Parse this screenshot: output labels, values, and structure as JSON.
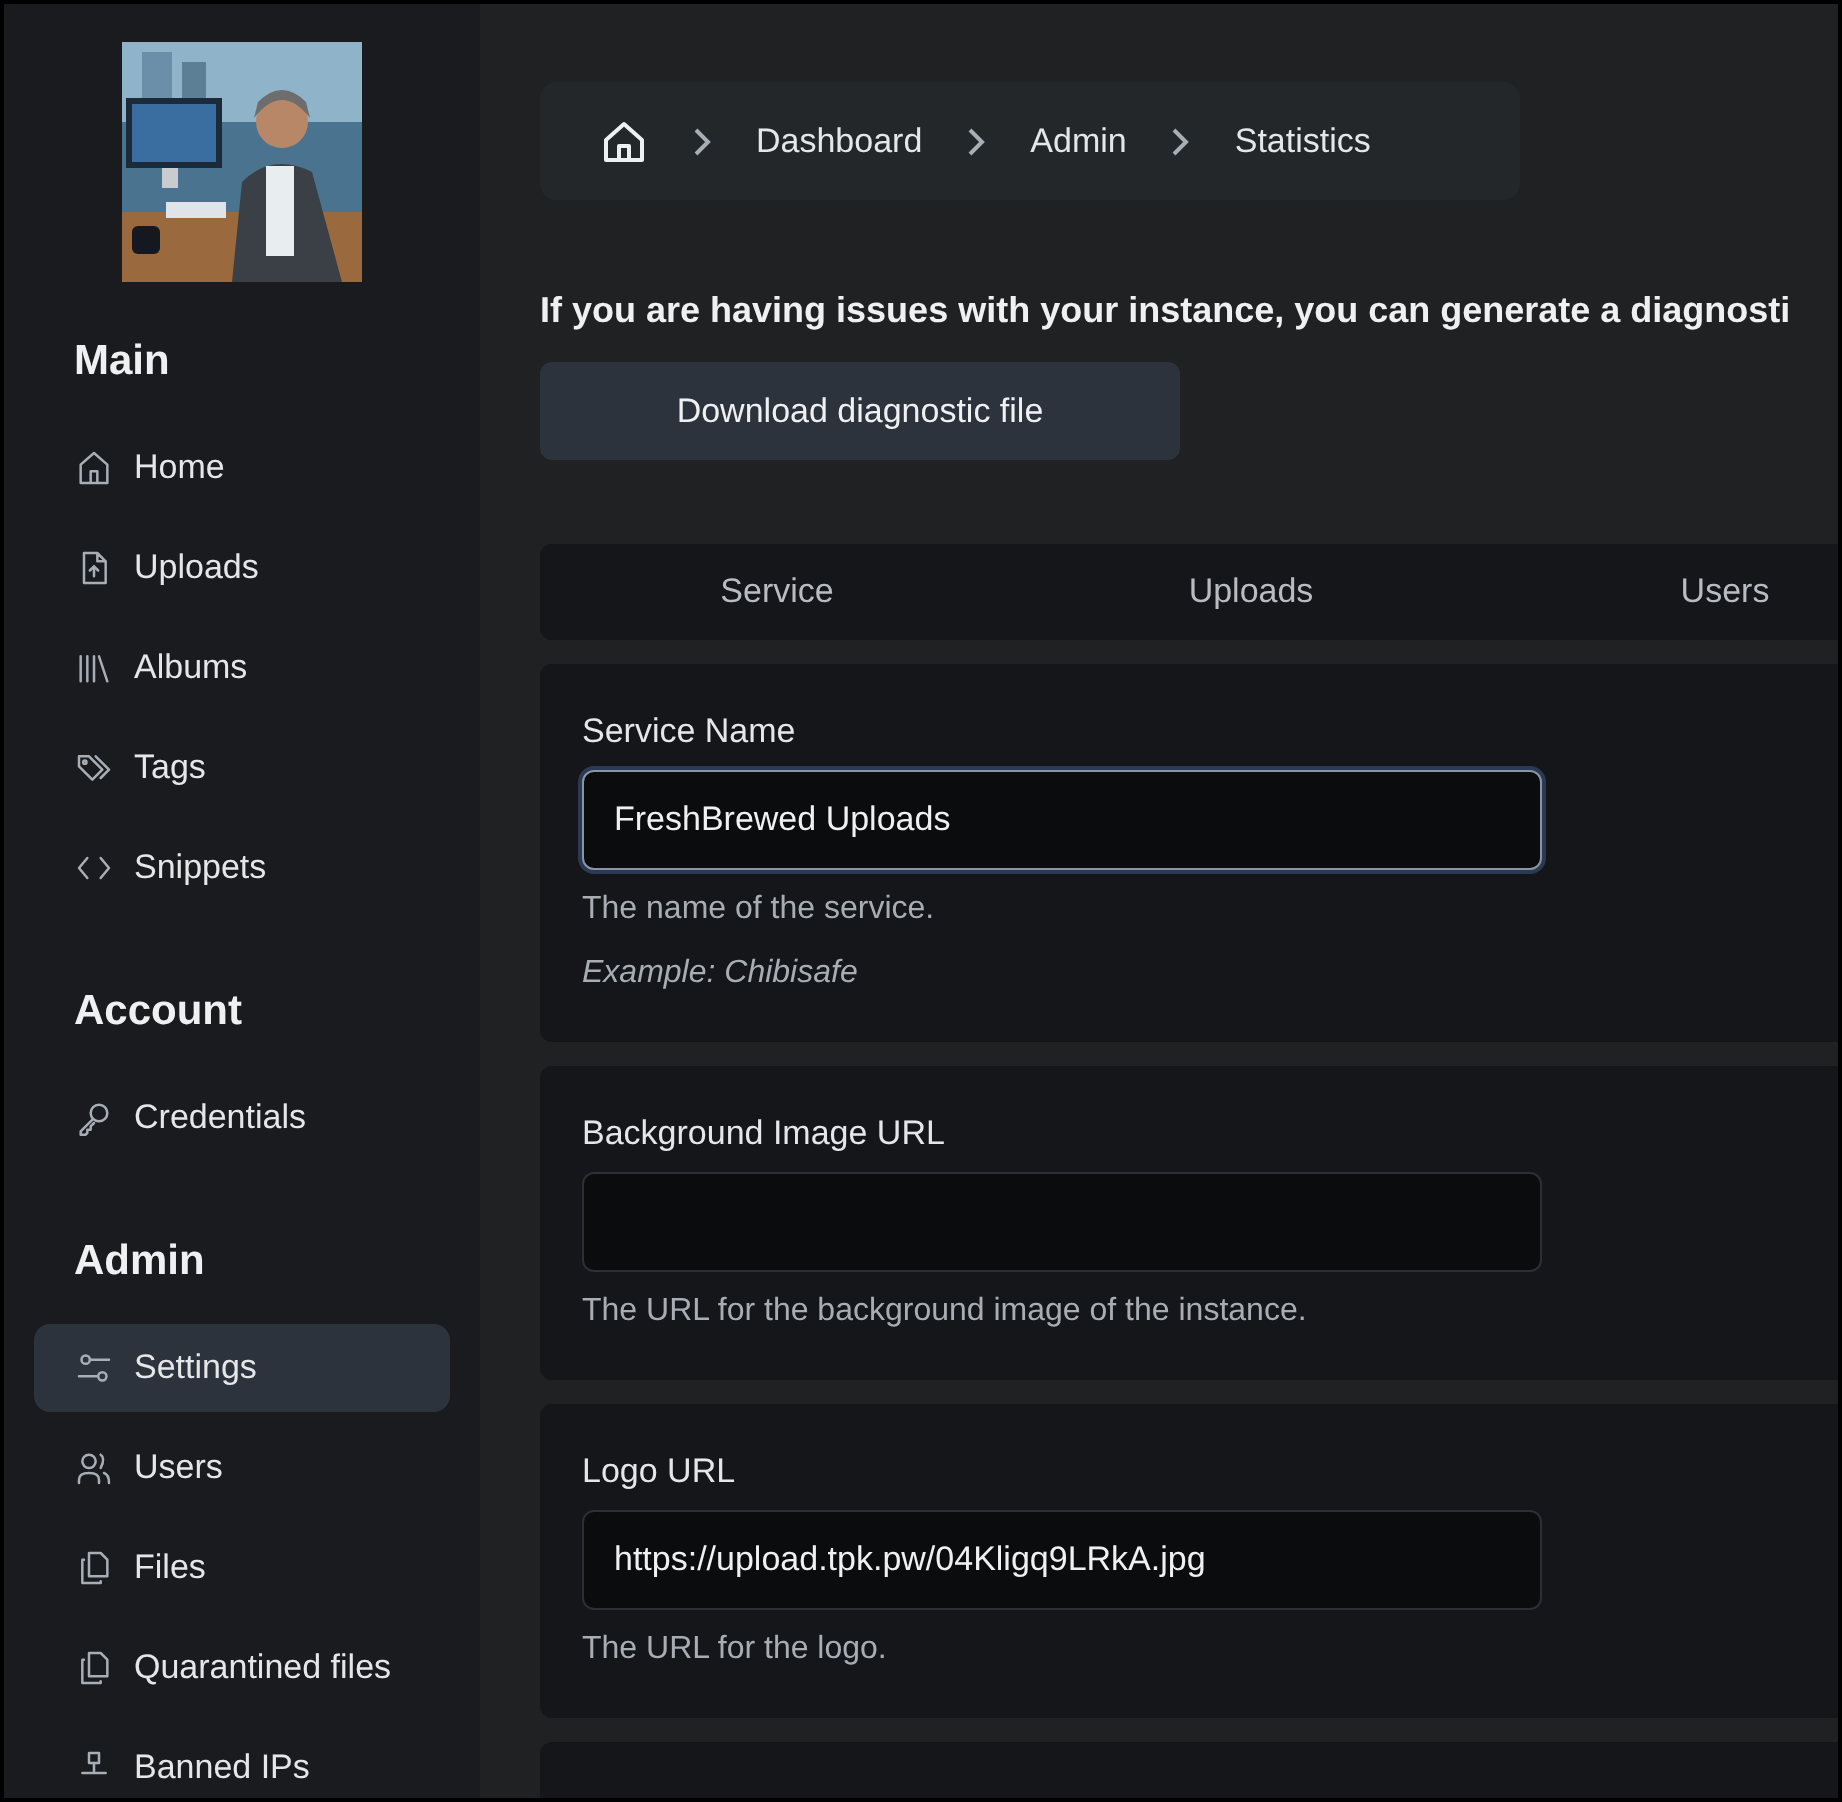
{
  "sidebar": {
    "sections": [
      {
        "title": "Main",
        "items": [
          {
            "label": "Home",
            "selected": false
          },
          {
            "label": "Uploads",
            "selected": false
          },
          {
            "label": "Albums",
            "selected": false
          },
          {
            "label": "Tags",
            "selected": false
          },
          {
            "label": "Snippets",
            "selected": false
          }
        ]
      },
      {
        "title": "Account",
        "items": [
          {
            "label": "Credentials",
            "selected": false
          }
        ]
      },
      {
        "title": "Admin",
        "items": [
          {
            "label": "Settings",
            "selected": true
          },
          {
            "label": "Users",
            "selected": false
          },
          {
            "label": "Files",
            "selected": false
          },
          {
            "label": "Quarantined files",
            "selected": false
          },
          {
            "label": "Banned IPs",
            "selected": false
          }
        ]
      }
    ]
  },
  "breadcrumb": [
    "Dashboard",
    "Admin",
    "Statistics"
  ],
  "notice": "If you are having issues with your instance, you can generate a diagnosti",
  "download_button": "Download diagnostic file",
  "tabs": [
    "Service",
    "Uploads",
    "Users"
  ],
  "settings": [
    {
      "label": "Service Name",
      "value": "FreshBrewed Uploads",
      "focused": true,
      "description": "The name of the service.",
      "example": "Example: Chibisafe"
    },
    {
      "label": "Background Image URL",
      "focused": false,
      "description": "The URL for the background image of the instance."
    },
    {
      "label": "Logo URL",
      "value": "https://upload.tpk.pw/04Kligq9LRkA.jpg",
      "focused": false,
      "description": "The URL for the logo."
    }
  ]
}
